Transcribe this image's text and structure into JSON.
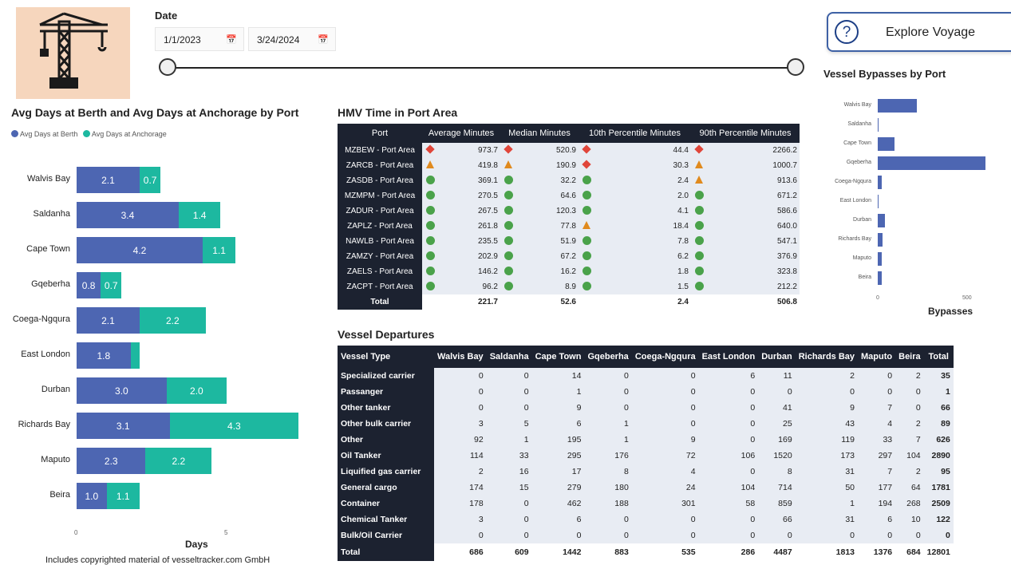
{
  "date_slicer": {
    "label": "Date",
    "start": "1/1/2023",
    "end": "3/24/2024",
    "calendar_icon": "calendar-icon"
  },
  "explore_button": {
    "label": "Explore Voyage",
    "icon": "question-icon"
  },
  "berth_chart": {
    "title": "Avg Days at Berth and Avg Days at Anchorage by Port",
    "legend": [
      "Avg Days at Berth",
      "Avg Days at Anchorage"
    ],
    "xlabel": "Days",
    "ticks": [
      "0",
      "5"
    ],
    "footnote": "Includes copyrighted material of vesseltracker.com GmbH"
  },
  "bypass_chart": {
    "title": "Vessel Bypasses by Port",
    "xlabel": "Bypasses",
    "ticks": [
      "0",
      "500"
    ]
  },
  "chart_data": [
    {
      "type": "bar",
      "orientation": "horizontal",
      "stacked": true,
      "title": "Avg Days at Berth and Avg Days at Anchorage by Port",
      "xlabel": "Days",
      "legend_placement": "top-left",
      "categories": [
        "Walvis Bay",
        "Saldanha",
        "Cape Town",
        "Gqeberha",
        "Coega-Ngqura",
        "East London",
        "Durban",
        "Richards Bay",
        "Maputo",
        "Beira"
      ],
      "series": [
        {
          "name": "Avg Days at Berth",
          "color": "#4d66b2",
          "values": [
            2.1,
            3.4,
            4.2,
            0.8,
            2.1,
            1.8,
            3.0,
            3.1,
            2.3,
            1.0
          ]
        },
        {
          "name": "Avg Days at Anchorage",
          "color": "#1db8a0",
          "values": [
            0.7,
            1.4,
            1.1,
            0.7,
            2.2,
            0.3,
            2.0,
            4.3,
            2.2,
            1.1
          ]
        }
      ],
      "data_labels": [
        [
          "2.1",
          "0.7"
        ],
        [
          "3.4",
          "1.4"
        ],
        [
          "4.2",
          "1.1"
        ],
        [
          "0.8",
          "0.7"
        ],
        [
          "2.1",
          "2.2"
        ],
        [
          "1.8",
          ""
        ],
        [
          "3.0",
          "2.0"
        ],
        [
          "3.1",
          "4.3"
        ],
        [
          "2.3",
          "2.2"
        ],
        [
          "1.0",
          "1.1"
        ]
      ],
      "xlim": [
        0,
        7.5
      ]
    },
    {
      "type": "bar",
      "orientation": "horizontal",
      "title": "Vessel Bypasses by Port",
      "xlabel": "Bypasses",
      "categories": [
        "Walvis Bay",
        "Saldanha",
        "Cape Town",
        "Gqeberha",
        "Coega-Ngqura",
        "East London",
        "Durban",
        "Richards Bay",
        "Maputo",
        "Beira"
      ],
      "values": [
        200,
        5,
        85,
        550,
        20,
        0,
        35,
        25,
        20,
        20
      ],
      "xlim": [
        0,
        620
      ]
    }
  ],
  "hmv": {
    "title": "HMV Time in Port Area",
    "headers": [
      "Port",
      "Average Minutes",
      "Median Minutes",
      "10th Percentile Minutes",
      "90th Percentile Minutes"
    ],
    "rows": [
      {
        "port": "MZBEW - Port Area",
        "avg": "973.7",
        "avg_s": "diamond",
        "med": "520.9",
        "med_s": "diamond",
        "p10": "44.4",
        "p10_s": "diamond",
        "p90": "2266.2",
        "p90_s": "diamond"
      },
      {
        "port": "ZARCB - Port Area",
        "avg": "419.8",
        "avg_s": "triangle",
        "med": "190.9",
        "med_s": "triangle",
        "p10": "30.3",
        "p10_s": "diamond",
        "p90": "1000.7",
        "p90_s": "triangle"
      },
      {
        "port": "ZASDB - Port Area",
        "avg": "369.1",
        "avg_s": "circle",
        "med": "32.2",
        "med_s": "circle",
        "p10": "2.4",
        "p10_s": "circle",
        "p90": "913.6",
        "p90_s": "triangle"
      },
      {
        "port": "MZMPM - Port Area",
        "avg": "270.5",
        "avg_s": "circle",
        "med": "64.6",
        "med_s": "circle",
        "p10": "2.0",
        "p10_s": "circle",
        "p90": "671.2",
        "p90_s": "circle"
      },
      {
        "port": "ZADUR - Port Area",
        "avg": "267.5",
        "avg_s": "circle",
        "med": "120.3",
        "med_s": "circle",
        "p10": "4.1",
        "p10_s": "circle",
        "p90": "586.6",
        "p90_s": "circle"
      },
      {
        "port": "ZAPLZ - Port Area",
        "avg": "261.8",
        "avg_s": "circle",
        "med": "77.8",
        "med_s": "circle",
        "p10": "18.4",
        "p10_s": "triangle",
        "p90": "640.0",
        "p90_s": "circle"
      },
      {
        "port": "NAWLB - Port Area",
        "avg": "235.5",
        "avg_s": "circle",
        "med": "51.9",
        "med_s": "circle",
        "p10": "7.8",
        "p10_s": "circle",
        "p90": "547.1",
        "p90_s": "circle"
      },
      {
        "port": "ZAMZY - Port Area",
        "avg": "202.9",
        "avg_s": "circle",
        "med": "67.2",
        "med_s": "circle",
        "p10": "6.2",
        "p10_s": "circle",
        "p90": "376.9",
        "p90_s": "circle"
      },
      {
        "port": "ZAELS - Port Area",
        "avg": "146.2",
        "avg_s": "circle",
        "med": "16.2",
        "med_s": "circle",
        "p10": "1.8",
        "p10_s": "circle",
        "p90": "323.8",
        "p90_s": "circle"
      },
      {
        "port": "ZACPT - Port Area",
        "avg": "96.2",
        "avg_s": "circle",
        "med": "8.9",
        "med_s": "circle",
        "p10": "1.5",
        "p10_s": "circle",
        "p90": "212.2",
        "p90_s": "circle"
      }
    ],
    "total": {
      "label": "Total",
      "avg": "221.7",
      "med": "52.6",
      "p10": "2.4",
      "p90": "506.8"
    }
  },
  "departures": {
    "title": "Vessel Departures",
    "headers": [
      "Vessel Type",
      "Walvis Bay",
      "Saldanha",
      "Cape Town",
      "Gqeberha",
      "Coega-Ngqura",
      "East London",
      "Durban",
      "Richards Bay",
      "Maputo",
      "Beira",
      "Total"
    ],
    "rows": [
      [
        "Specialized carrier",
        "0",
        "0",
        "14",
        "0",
        "0",
        "6",
        "11",
        "2",
        "0",
        "2",
        "35"
      ],
      [
        "Passanger",
        "0",
        "0",
        "1",
        "0",
        "0",
        "0",
        "0",
        "0",
        "0",
        "0",
        "1"
      ],
      [
        "Other tanker",
        "0",
        "0",
        "9",
        "0",
        "0",
        "0",
        "41",
        "9",
        "7",
        "0",
        "66"
      ],
      [
        "Other bulk carrier",
        "3",
        "5",
        "6",
        "1",
        "0",
        "0",
        "25",
        "43",
        "4",
        "2",
        "89"
      ],
      [
        "Other",
        "92",
        "1",
        "195",
        "1",
        "9",
        "0",
        "169",
        "119",
        "33",
        "7",
        "626"
      ],
      [
        "Oil Tanker",
        "114",
        "33",
        "295",
        "176",
        "72",
        "106",
        "1520",
        "173",
        "297",
        "104",
        "2890"
      ],
      [
        "Liquified gas carrier",
        "2",
        "16",
        "17",
        "8",
        "4",
        "0",
        "8",
        "31",
        "7",
        "2",
        "95"
      ],
      [
        "General cargo",
        "174",
        "15",
        "279",
        "180",
        "24",
        "104",
        "714",
        "50",
        "177",
        "64",
        "1781"
      ],
      [
        "Container",
        "178",
        "0",
        "462",
        "188",
        "301",
        "58",
        "859",
        "1",
        "194",
        "268",
        "2509"
      ],
      [
        "Chemical Tanker",
        "3",
        "0",
        "6",
        "0",
        "0",
        "0",
        "66",
        "31",
        "6",
        "10",
        "122"
      ],
      [
        "Bulk/Oil Carrier",
        "0",
        "0",
        "0",
        "0",
        "0",
        "0",
        "0",
        "0",
        "0",
        "0",
        "0"
      ]
    ],
    "total": [
      "Total",
      "686",
      "609",
      "1442",
      "883",
      "535",
      "286",
      "4487",
      "1813",
      "1376",
      "684",
      "12801"
    ]
  }
}
